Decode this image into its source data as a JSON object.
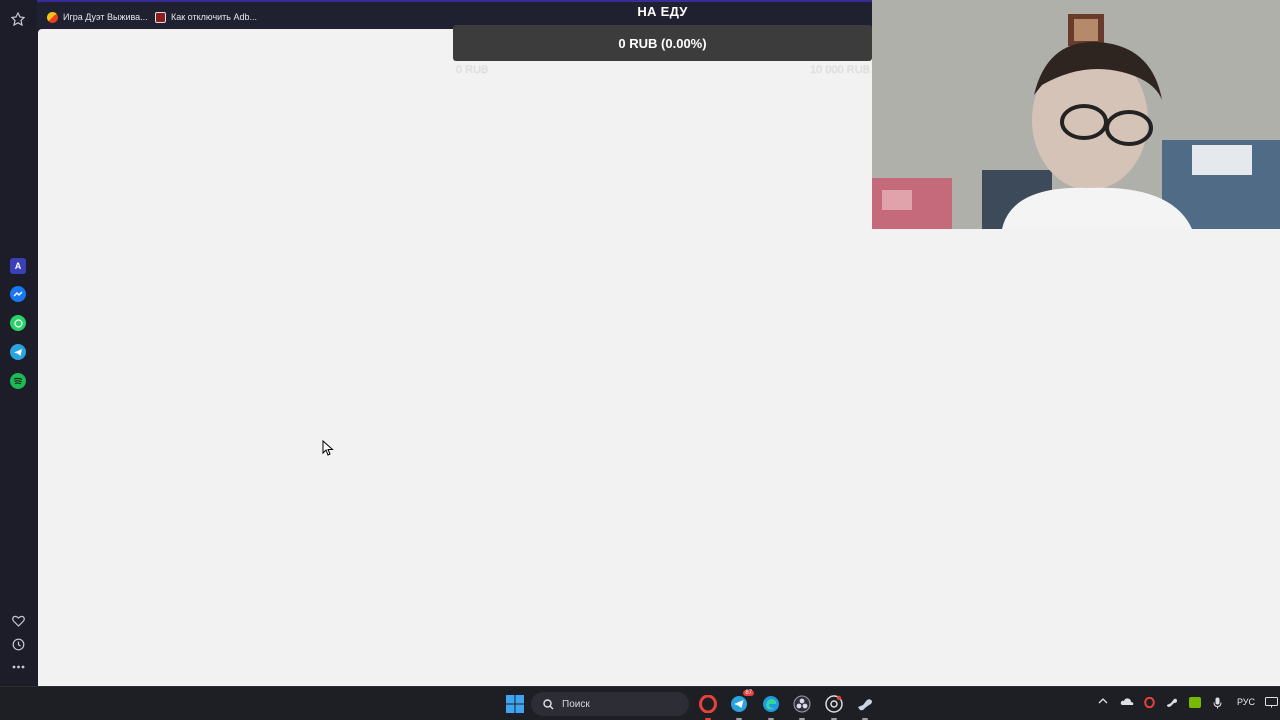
{
  "browser": {
    "bookmarks": [
      {
        "label": "Игра Дуэт Выжива...",
        "icon": "ghost-favicon-icon"
      },
      {
        "label": "Как отключить Adb...",
        "icon": "page-favicon-icon"
      }
    ],
    "sidebar_icons": [
      "pin-icon",
      "aria-icon",
      "messenger-icon",
      "whatsapp-icon",
      "telegram-icon",
      "spotify-icon",
      "heart-icon",
      "history-icon",
      "more-icon"
    ]
  },
  "widget": {
    "title": "НА ЕДУ",
    "amount": "0 RUB (0.00%)",
    "progress": 0.0,
    "min_label": "0 RUB",
    "max_label": "10 000 RUB"
  },
  "taskbar": {
    "search_placeholder": "Поиск",
    "apps": [
      "windows-start-icon",
      "search-icon",
      "opera-icon",
      "telegram-icon",
      "edge-icon",
      "obs-icon",
      "chrome-icon",
      "steam-icon"
    ],
    "telegram_badge": "87",
    "tray_language": "РУС",
    "colors": {
      "accent_red": "#e8403a",
      "taskbar_bg": "#1e1f24"
    }
  }
}
